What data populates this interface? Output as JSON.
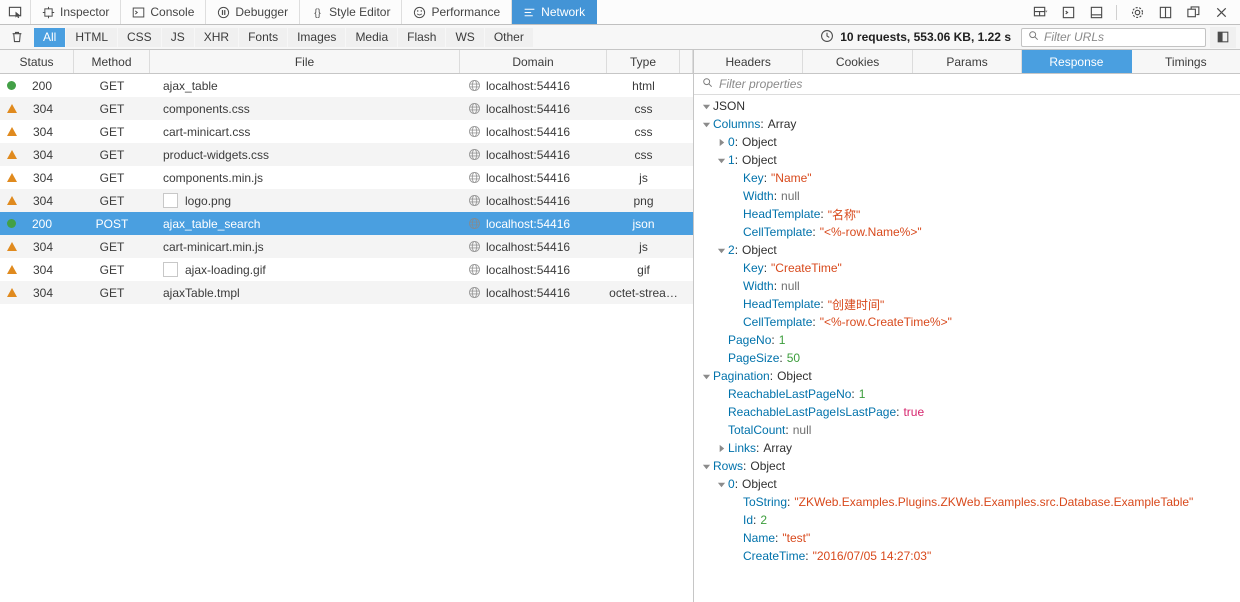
{
  "toolbox": {
    "picker_icon": "element-picker-icon",
    "tabs": [
      {
        "label": "Inspector",
        "icon": "inspector-icon",
        "selected": false
      },
      {
        "label": "Console",
        "icon": "console-icon",
        "selected": false
      },
      {
        "label": "Debugger",
        "icon": "debugger-icon",
        "selected": false
      },
      {
        "label": "Style Editor",
        "icon": "style-editor-icon",
        "selected": false
      },
      {
        "label": "Performance",
        "icon": "performance-icon",
        "selected": false
      },
      {
        "label": "Network",
        "icon": "network-icon",
        "selected": true
      }
    ],
    "right_buttons": [
      {
        "name": "responsive-design-mode-icon"
      },
      {
        "name": "split-console-icon"
      },
      {
        "name": "dock-bottom-icon"
      },
      {
        "name": "settings-gear-icon"
      },
      {
        "name": "dock-side-icon"
      },
      {
        "name": "detach-window-icon"
      },
      {
        "name": "close-icon"
      }
    ]
  },
  "network_toolbar": {
    "clear_icon": "trash-icon",
    "filters": [
      {
        "label": "All",
        "active": true
      },
      {
        "label": "HTML",
        "active": false
      },
      {
        "label": "CSS",
        "active": false
      },
      {
        "label": "JS",
        "active": false
      },
      {
        "label": "XHR",
        "active": false
      },
      {
        "label": "Fonts",
        "active": false
      },
      {
        "label": "Images",
        "active": false
      },
      {
        "label": "Media",
        "active": false
      },
      {
        "label": "Flash",
        "active": false
      },
      {
        "label": "WS",
        "active": false
      },
      {
        "label": "Other",
        "active": false
      }
    ],
    "summary_icon": "clock-icon",
    "summary": "10 requests, 553.06 KB, 1.22 s",
    "url_filter_icon": "search-icon",
    "url_filter_placeholder": "Filter URLs",
    "url_filter_value": "",
    "toggle_details_icon": "toggle-details-pane-icon"
  },
  "request_table": {
    "columns": [
      "Status",
      "Method",
      "File",
      "Domain",
      "Type"
    ],
    "rows": [
      {
        "status": "200",
        "indicator": "dot",
        "method": "GET",
        "file": "ajax_table",
        "thumb": false,
        "domain": "localhost:54416",
        "type": "html",
        "selected": false
      },
      {
        "status": "304",
        "indicator": "tri",
        "method": "GET",
        "file": "components.css",
        "thumb": false,
        "domain": "localhost:54416",
        "type": "css",
        "selected": false
      },
      {
        "status": "304",
        "indicator": "tri",
        "method": "GET",
        "file": "cart-minicart.css",
        "thumb": false,
        "domain": "localhost:54416",
        "type": "css",
        "selected": false
      },
      {
        "status": "304",
        "indicator": "tri",
        "method": "GET",
        "file": "product-widgets.css",
        "thumb": false,
        "domain": "localhost:54416",
        "type": "css",
        "selected": false
      },
      {
        "status": "304",
        "indicator": "tri",
        "method": "GET",
        "file": "components.min.js",
        "thumb": false,
        "domain": "localhost:54416",
        "type": "js",
        "selected": false
      },
      {
        "status": "304",
        "indicator": "tri",
        "method": "GET",
        "file": "logo.png",
        "thumb": true,
        "domain": "localhost:54416",
        "type": "png",
        "selected": false
      },
      {
        "status": "200",
        "indicator": "dot",
        "method": "POST",
        "file": "ajax_table_search",
        "thumb": false,
        "domain": "localhost:54416",
        "type": "json",
        "selected": true
      },
      {
        "status": "304",
        "indicator": "tri",
        "method": "GET",
        "file": "cart-minicart.min.js",
        "thumb": false,
        "domain": "localhost:54416",
        "type": "js",
        "selected": false
      },
      {
        "status": "304",
        "indicator": "tri",
        "method": "GET",
        "file": "ajax-loading.gif",
        "thumb": true,
        "domain": "localhost:54416",
        "type": "gif",
        "selected": false
      },
      {
        "status": "304",
        "indicator": "tri",
        "method": "GET",
        "file": "ajaxTable.tmpl",
        "thumb": false,
        "domain": "localhost:54416",
        "type": "octet-strea…",
        "selected": false
      }
    ]
  },
  "details": {
    "tabs": [
      {
        "label": "Headers",
        "selected": false
      },
      {
        "label": "Cookies",
        "selected": false
      },
      {
        "label": "Params",
        "selected": false
      },
      {
        "label": "Response",
        "selected": true
      },
      {
        "label": "Timings",
        "selected": false
      }
    ],
    "prop_filter_icon": "search-icon",
    "prop_filter_placeholder": "Filter properties",
    "prop_filter_value": "",
    "json_tree": [
      {
        "indent": 0,
        "twisty": "open",
        "label": "JSON",
        "label_style": "plain",
        "value": "",
        "value_type": "none"
      },
      {
        "indent": 0,
        "twisty": "open",
        "label": "Columns",
        "label_style": "key",
        "value": "Array",
        "value_type": "obj"
      },
      {
        "indent": 1,
        "twisty": "closed",
        "label": "0",
        "label_style": "key",
        "value": "Object",
        "value_type": "obj"
      },
      {
        "indent": 1,
        "twisty": "open",
        "label": "1",
        "label_style": "key",
        "value": "Object",
        "value_type": "obj"
      },
      {
        "indent": 2,
        "twisty": "none",
        "label": "Key",
        "label_style": "key",
        "value": "\"Name\"",
        "value_type": "str"
      },
      {
        "indent": 2,
        "twisty": "none",
        "label": "Width",
        "label_style": "key",
        "value": "null",
        "value_type": "null"
      },
      {
        "indent": 2,
        "twisty": "none",
        "label": "HeadTemplate",
        "label_style": "key",
        "value": "\"名称\"",
        "value_type": "str"
      },
      {
        "indent": 2,
        "twisty": "none",
        "label": "CellTemplate",
        "label_style": "key",
        "value": "\"<%-row.Name%>\"",
        "value_type": "str"
      },
      {
        "indent": 1,
        "twisty": "open",
        "label": "2",
        "label_style": "key",
        "value": "Object",
        "value_type": "obj"
      },
      {
        "indent": 2,
        "twisty": "none",
        "label": "Key",
        "label_style": "key",
        "value": "\"CreateTime\"",
        "value_type": "str"
      },
      {
        "indent": 2,
        "twisty": "none",
        "label": "Width",
        "label_style": "key",
        "value": "null",
        "value_type": "null"
      },
      {
        "indent": 2,
        "twisty": "none",
        "label": "HeadTemplate",
        "label_style": "key",
        "value": "\"创建时间\"",
        "value_type": "str"
      },
      {
        "indent": 2,
        "twisty": "none",
        "label": "CellTemplate",
        "label_style": "key",
        "value": "\"<%-row.CreateTime%>\"",
        "value_type": "str"
      },
      {
        "indent": 1,
        "twisty": "none",
        "label": "PageNo",
        "label_style": "key",
        "value": "1",
        "value_type": "num"
      },
      {
        "indent": 1,
        "twisty": "none",
        "label": "PageSize",
        "label_style": "key",
        "value": "50",
        "value_type": "num"
      },
      {
        "indent": 0,
        "twisty": "open",
        "label": "Pagination",
        "label_style": "key",
        "value": "Object",
        "value_type": "obj"
      },
      {
        "indent": 1,
        "twisty": "none",
        "label": "ReachableLastPageNo",
        "label_style": "key",
        "value": "1",
        "value_type": "num"
      },
      {
        "indent": 1,
        "twisty": "none",
        "label": "ReachableLastPageIsLastPage",
        "label_style": "key",
        "value": "true",
        "value_type": "bool"
      },
      {
        "indent": 1,
        "twisty": "none",
        "label": "TotalCount",
        "label_style": "key",
        "value": "null",
        "value_type": "null"
      },
      {
        "indent": 1,
        "twisty": "closed",
        "label": "Links",
        "label_style": "key",
        "value": "Array",
        "value_type": "obj"
      },
      {
        "indent": 0,
        "twisty": "open",
        "label": "Rows",
        "label_style": "key",
        "value": "Object",
        "value_type": "obj"
      },
      {
        "indent": 1,
        "twisty": "open",
        "label": "0",
        "label_style": "key",
        "value": "Object",
        "value_type": "obj"
      },
      {
        "indent": 2,
        "twisty": "none",
        "label": "ToString",
        "label_style": "key",
        "value": "\"ZKWeb.Examples.Plugins.ZKWeb.Examples.src.Database.ExampleTable\"",
        "value_type": "str"
      },
      {
        "indent": 2,
        "twisty": "none",
        "label": "Id",
        "label_style": "key",
        "value": "2",
        "value_type": "num"
      },
      {
        "indent": 2,
        "twisty": "none",
        "label": "Name",
        "label_style": "key",
        "value": "\"test\"",
        "value_type": "str"
      },
      {
        "indent": 2,
        "twisty": "none",
        "label": "CreateTime",
        "label_style": "key",
        "value": "\"2016/07/05 14:27:03\"",
        "value_type": "str"
      }
    ]
  },
  "colors": {
    "accent": "#4a9fe0",
    "status_ok": "#43a047",
    "status_cached": "#e08a1e",
    "string": "#d8491c",
    "number": "#3c9d3c",
    "boolean": "#d6246d",
    "key": "#0072ab"
  }
}
